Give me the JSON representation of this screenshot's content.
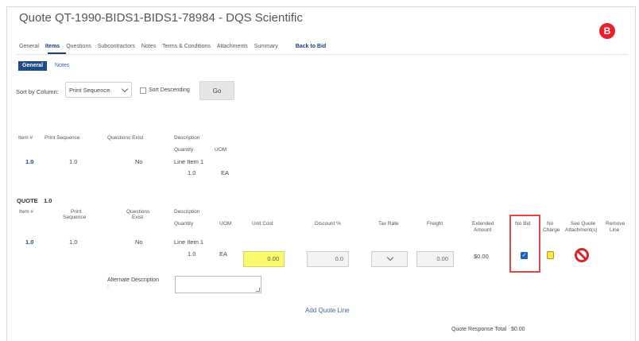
{
  "title": "Quote QT-1990-BIDS1-BIDS1-78984 - DQS Scientific",
  "avatar_letter": "B",
  "tabs": [
    "General",
    "Items",
    "Questions",
    "Subcontractors",
    "Notes",
    "Terms & Conditions",
    "Attachments",
    "Summary"
  ],
  "back_to_bid": "Back to Bid",
  "subtabs": {
    "general": "General",
    "notes": "Notes"
  },
  "sort": {
    "label": "Sort by Column:",
    "selected": "Print Sequence",
    "descending_label": "Sort Descending",
    "go_label": "Go"
  },
  "items_table": {
    "headers": {
      "item": "Item #",
      "print_seq": "Print Sequence",
      "questions": "Questions Exist",
      "description": "Description",
      "quantity": "Quantity",
      "uom": "UOM"
    },
    "row": {
      "item": "1.0",
      "print_seq": "1.0",
      "questions": "No",
      "description": "Line Item 1",
      "quantity": "1.0",
      "uom": "EA"
    }
  },
  "quote": {
    "label": "QUOTE",
    "number": "1.0",
    "headers": {
      "item": "Item #",
      "print_seq_1": "Print",
      "print_seq_2": "Sequence",
      "questions_1": "Questions",
      "questions_2": "Exist",
      "description": "Description",
      "quantity": "Quantity",
      "uom": "UOM",
      "unit_cost": "Unit Cost",
      "discount": "Discount %",
      "tax_rate": "Tax Rate",
      "freight": "Freight",
      "extended_1": "Extended",
      "extended_2": "Amount",
      "no_bid": "No Bid",
      "no_charge_1": "No",
      "no_charge_2": "Charge",
      "see_attach_1": "See Quote",
      "see_attach_2": "Attachment(s)",
      "remove_1": "Remove",
      "remove_2": "Line"
    },
    "row": {
      "item": "1.0",
      "print_seq": "1.0",
      "questions": "No",
      "description": "Line Item 1",
      "quantity": "1.0",
      "uom": "EA",
      "unit_cost": "0.00",
      "discount": "0.0",
      "freight": "0.00",
      "extended": "$0.00"
    },
    "alternate_description_label": "Alternate Description",
    "alternate_description_colon": ":",
    "add_quote_line": "Add Quote Line",
    "response_total_label": "Quote Response Total",
    "response_total_value": "$0.00"
  },
  "colors": {
    "accent": "#1e4b8a",
    "highlight": "#fafa6e",
    "alert": "#e14545",
    "remove": "#d9252a"
  }
}
